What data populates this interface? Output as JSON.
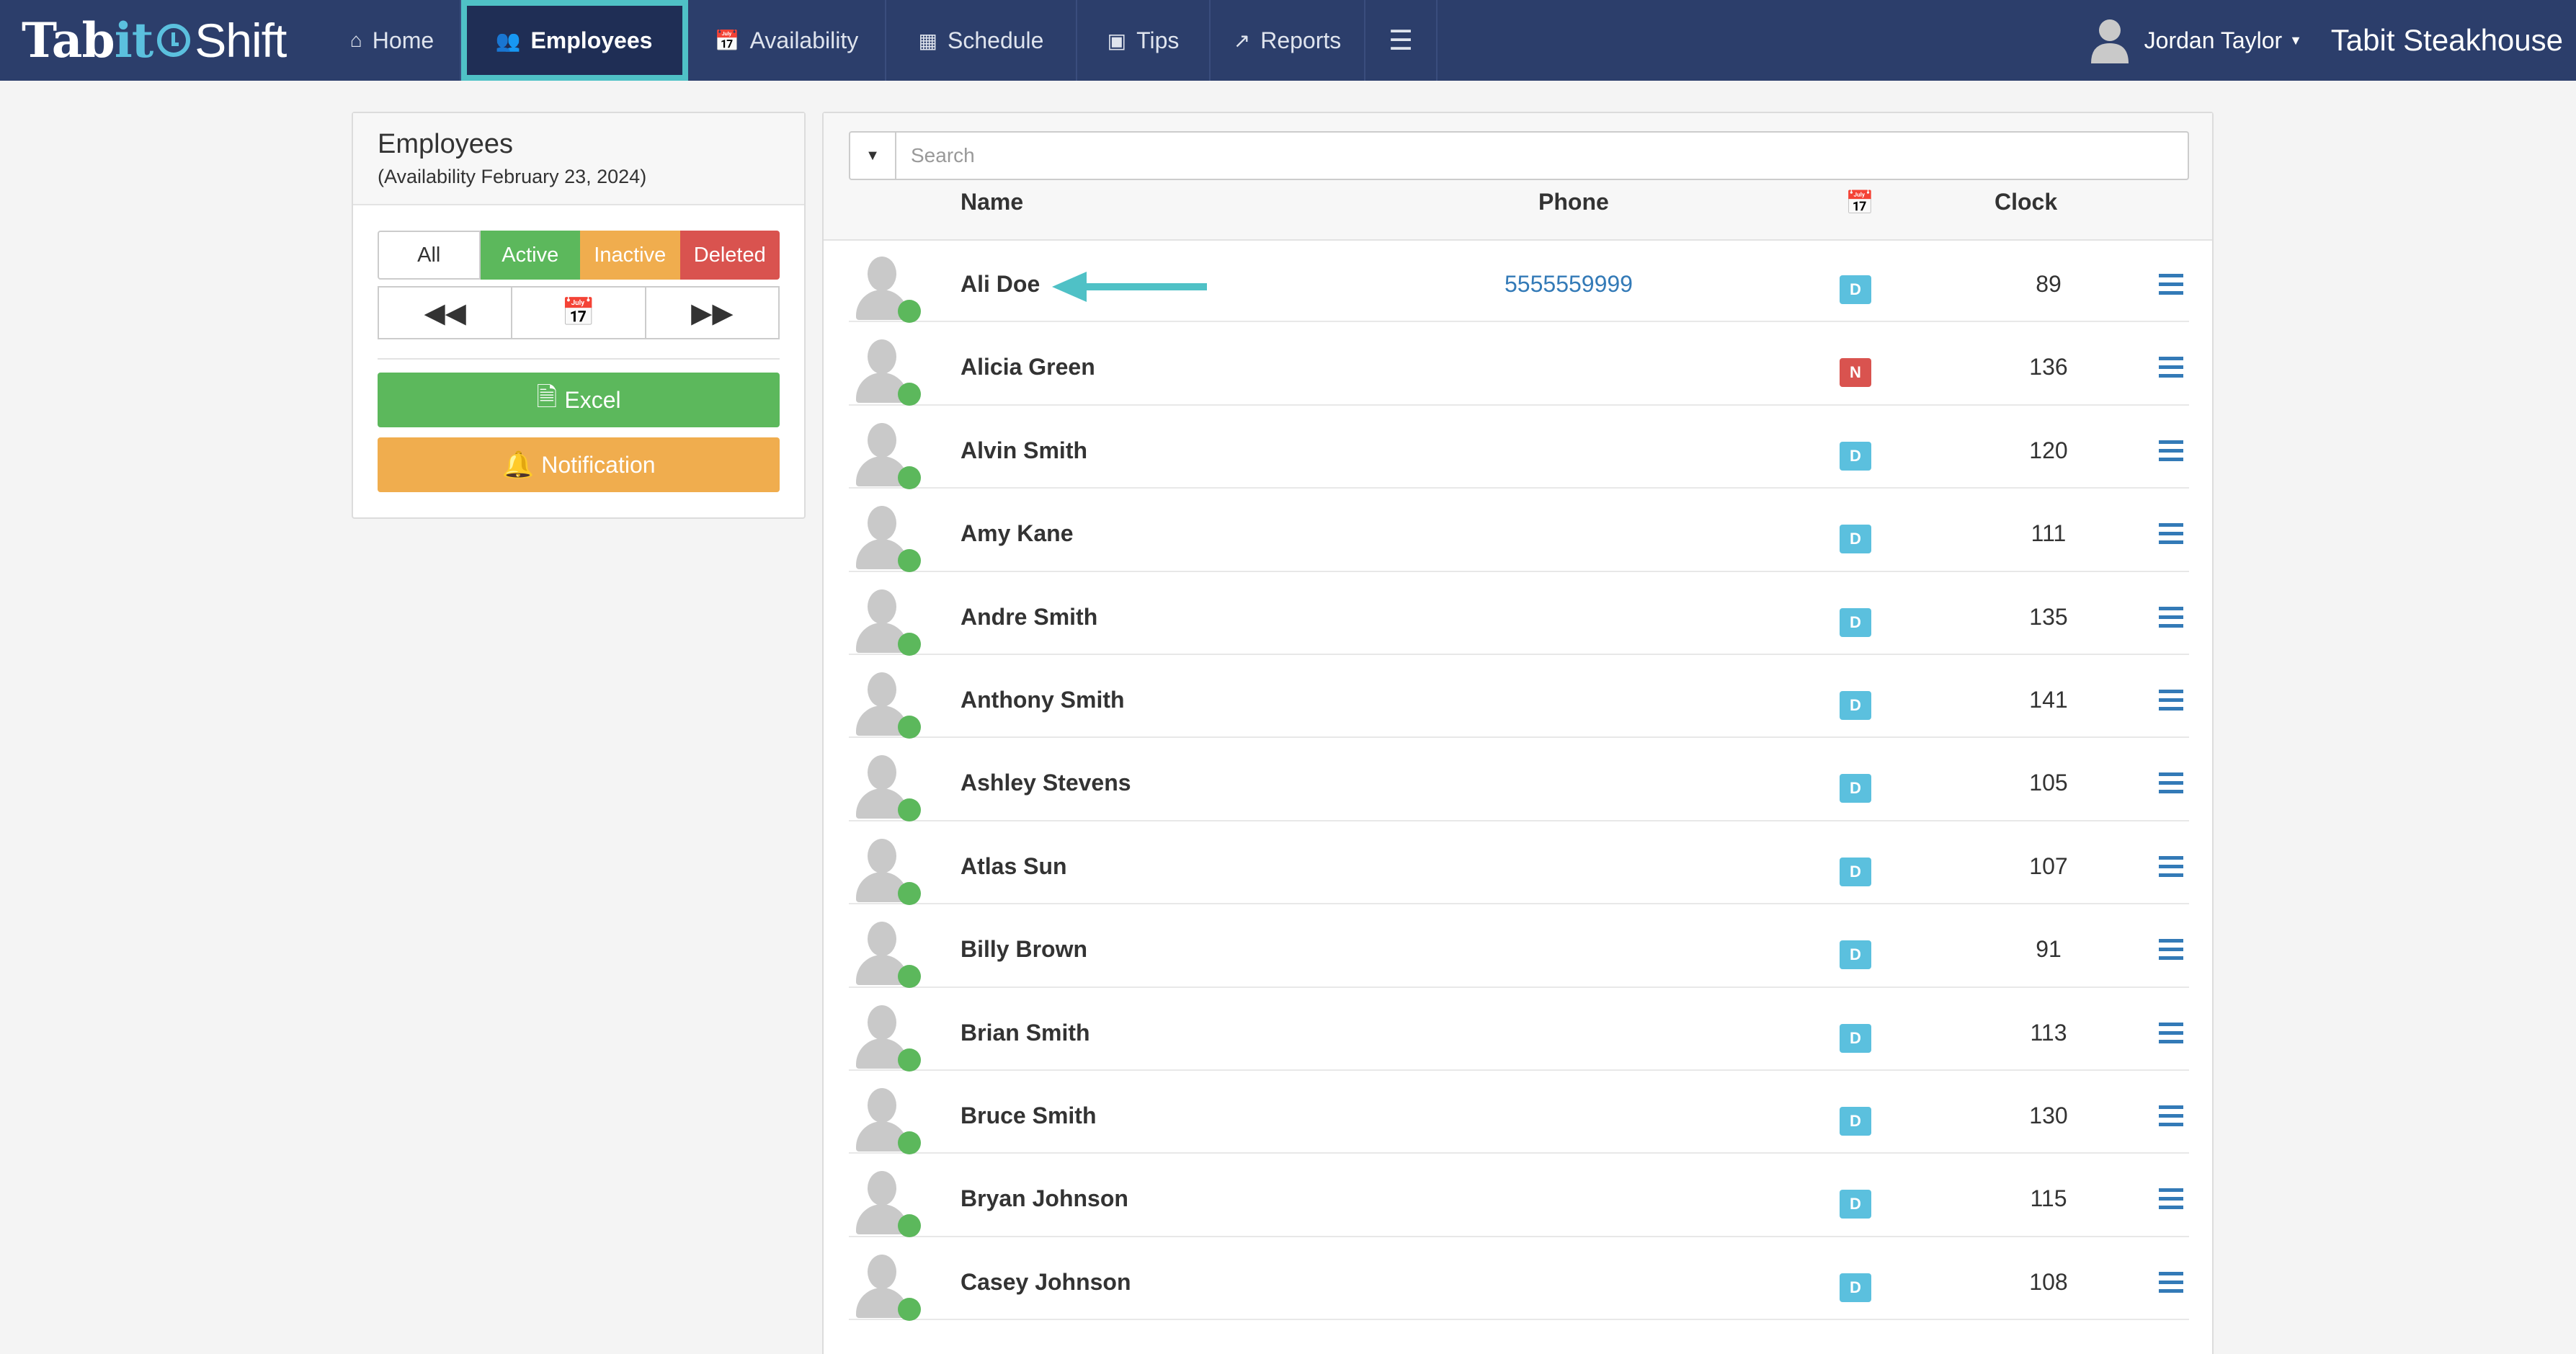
{
  "app": {
    "brand_part1": "Tab",
    "brand_part2": "it",
    "brand_part3": "Shift",
    "restaurant": "Tabit Steakhouse",
    "user": "Jordan Taylor"
  },
  "nav": {
    "home": "Home",
    "employees": "Employees",
    "availability": "Availability",
    "schedule": "Schedule",
    "tips": "Tips",
    "reports": "Reports"
  },
  "left": {
    "title": "Employees",
    "subtitle": "(Availability February 23, 2024)",
    "filters": {
      "all": "All",
      "active": "Active",
      "inactive": "Inactive",
      "deleted": "Deleted"
    },
    "excel": "Excel",
    "notification": "Notification"
  },
  "search": {
    "placeholder": "Search"
  },
  "columns": {
    "name": "Name",
    "phone": "Phone",
    "clock": "Clock"
  },
  "colors": {
    "D": "#5bc0de",
    "N": "#d9534f"
  },
  "employees": [
    {
      "name": "Ali Doe",
      "phone": "5555559999",
      "badge": "D",
      "clock": "89"
    },
    {
      "name": "Alicia Green",
      "phone": "",
      "badge": "N",
      "clock": "136"
    },
    {
      "name": "Alvin Smith",
      "phone": "",
      "badge": "D",
      "clock": "120"
    },
    {
      "name": "Amy Kane",
      "phone": "",
      "badge": "D",
      "clock": "111"
    },
    {
      "name": "Andre Smith",
      "phone": "",
      "badge": "D",
      "clock": "135"
    },
    {
      "name": "Anthony Smith",
      "phone": "",
      "badge": "D",
      "clock": "141"
    },
    {
      "name": "Ashley Stevens",
      "phone": "",
      "badge": "D",
      "clock": "105"
    },
    {
      "name": "Atlas Sun",
      "phone": "",
      "badge": "D",
      "clock": "107"
    },
    {
      "name": "Billy Brown",
      "phone": "",
      "badge": "D",
      "clock": "91"
    },
    {
      "name": "Brian Smith",
      "phone": "",
      "badge": "D",
      "clock": "113"
    },
    {
      "name": "Bruce Smith",
      "phone": "",
      "badge": "D",
      "clock": "130"
    },
    {
      "name": "Bryan Johnson",
      "phone": "",
      "badge": "D",
      "clock": "115"
    },
    {
      "name": "Casey Johnson",
      "phone": "",
      "badge": "D",
      "clock": "108"
    }
  ]
}
